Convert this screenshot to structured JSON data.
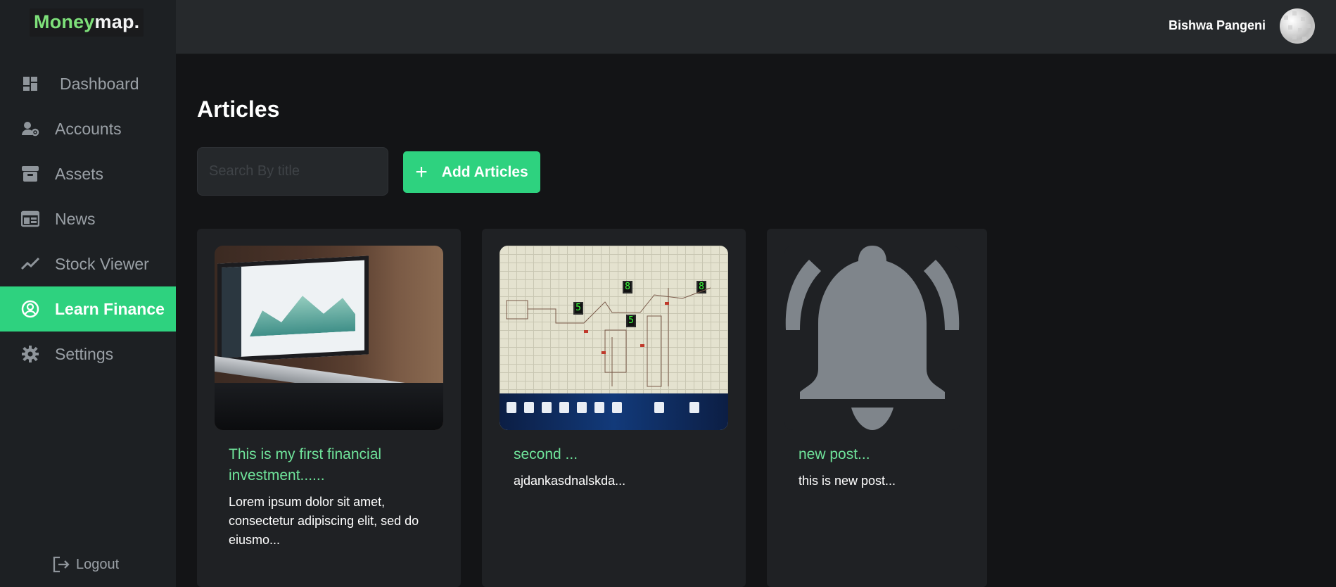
{
  "app": {
    "logo_part1": "Money",
    "logo_part2": "map."
  },
  "sidebar": {
    "items": [
      {
        "label": "Dashboard",
        "icon": "dashboard-icon",
        "active": false
      },
      {
        "label": "Accounts",
        "icon": "user-gear-icon",
        "active": false
      },
      {
        "label": "Assets",
        "icon": "archive-box-icon",
        "active": false
      },
      {
        "label": "News",
        "icon": "newspaper-icon",
        "active": false
      },
      {
        "label": "Stock Viewer",
        "icon": "trend-line-icon",
        "active": false
      },
      {
        "label": "Learn Finance",
        "icon": "user-circle-icon",
        "active": true
      },
      {
        "label": "Settings",
        "icon": "gear-icon",
        "active": false
      }
    ],
    "logout_label": "Logout"
  },
  "header": {
    "username": "Bishwa Pangeni"
  },
  "main": {
    "title": "Articles",
    "search_placeholder": "Search By title",
    "add_button_label": "Add Articles",
    "articles": [
      {
        "title": "This is my first financial investment......",
        "description": "Lorem ipsum dolor sit amet, consectetur adipiscing elit, sed do eiusmo...",
        "image": "laptop-dashboard-photo"
      },
      {
        "title": "second ...",
        "description": "ajdankasdnalskda...",
        "image": "circuit-screenshot"
      },
      {
        "title": "new post...",
        "description": "this is new post...",
        "image": "bell-icon"
      }
    ]
  },
  "colors": {
    "accent": "#2ed27f",
    "accent_text": "#6fe39a",
    "sidebar_bg": "#1d2023",
    "header_bg": "#26292c",
    "page_bg": "#131416"
  }
}
